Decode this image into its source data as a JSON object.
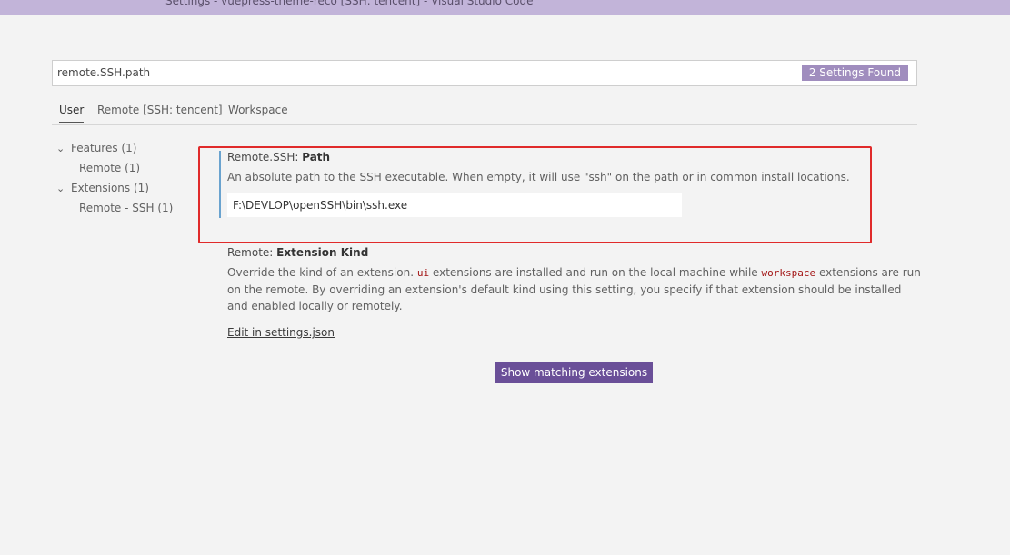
{
  "window": {
    "title": "Settings - vuepress-theme-reco [SSH: tencent] - Visual Studio Code"
  },
  "search": {
    "value": "remote.SSH.path",
    "results_badge": "2 Settings Found"
  },
  "tabs": [
    {
      "label": "User",
      "active": true
    },
    {
      "label": "Remote [SSH: tencent]",
      "active": false
    },
    {
      "label": "Workspace",
      "active": false
    }
  ],
  "toc": [
    {
      "label": "Features (1)",
      "expanded": true
    },
    {
      "label": "Remote (1)"
    },
    {
      "label": "Extensions (1)",
      "expanded": true
    },
    {
      "label": "Remote - SSH (1)"
    }
  ],
  "settings": [
    {
      "category": "Remote.SSH: ",
      "name": "Path",
      "description": "An absolute path to the SSH executable. When empty, it will use \"ssh\" on the path or in common install locations.",
      "value": "F:\\DEVLOP\\openSSH\\bin\\ssh.exe"
    },
    {
      "category": "Remote: ",
      "name": "Extension Kind",
      "description_parts": {
        "p1": "Override the kind of an extension. ",
        "code1": "ui",
        "p2": " extensions are installed and run on the local machine while ",
        "code2": "workspace",
        "p3": " extensions are run on the remote. By overriding an extension's default kind using this setting, you specify if that extension should be installed and enabled locally or remotely."
      },
      "link": "Edit in settings.json"
    }
  ],
  "actions": {
    "show_extensions": "Show matching extensions"
  },
  "colors": {
    "title_bar": "#c2b4d9",
    "badge": "#a08dbe",
    "button": "#6a4f98",
    "highlight_border": "#e02a2a",
    "focus_bar": "#6aa3cf"
  },
  "icons": {
    "toc_expanded": "chevron-down-icon"
  }
}
